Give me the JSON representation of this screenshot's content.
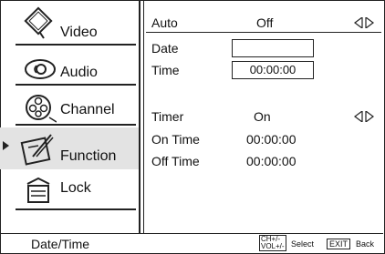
{
  "menu": {
    "items": [
      {
        "label": "Video",
        "icon": "video-icon"
      },
      {
        "label": "Audio",
        "icon": "audio-icon"
      },
      {
        "label": "Channel",
        "icon": "channel-icon"
      },
      {
        "label": "Function",
        "icon": "function-icon"
      },
      {
        "label": "Lock",
        "icon": "lock-icon"
      }
    ],
    "selected": "Function"
  },
  "settings": {
    "auto": {
      "label": "Auto",
      "value": "Off"
    },
    "date": {
      "label": "Date",
      "value": ""
    },
    "time": {
      "label": "Time",
      "value": "00:00:00"
    },
    "timer": {
      "label": "Timer",
      "value": "On"
    },
    "on_time": {
      "label": "On Time",
      "value": "00:00:00"
    },
    "off_time": {
      "label": "Off Time",
      "value": "00:00:00"
    }
  },
  "footer": {
    "title": "Date/Time",
    "key1_top": "CH+/-",
    "key1_bottom": "VOL+/-",
    "select_label": "Select",
    "exit_key": "EXIT",
    "back_label": "Back"
  }
}
